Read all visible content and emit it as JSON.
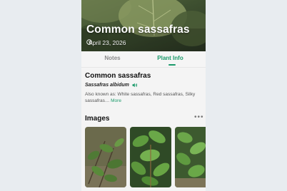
{
  "plant": {
    "title": "Common sassafras",
    "date": "April 23, 2026",
    "name": "Common sassafras",
    "scientific_name": "Sassafras albidum",
    "also_known_as": "Also known as: White sassafras, Red sassafras, Silky sassafras…",
    "more_label": "More"
  },
  "tabs": [
    {
      "label": "Notes",
      "active": false
    },
    {
      "label": "Plant Info",
      "active": true
    }
  ],
  "images_section": {
    "title": "Images",
    "menu_glyph": "•••"
  },
  "colors": {
    "accent": "#1a9a6a",
    "background": "#f4f4f4"
  },
  "icons": [
    "clock-icon",
    "speaker-icon",
    "ellipsis-icon"
  ]
}
